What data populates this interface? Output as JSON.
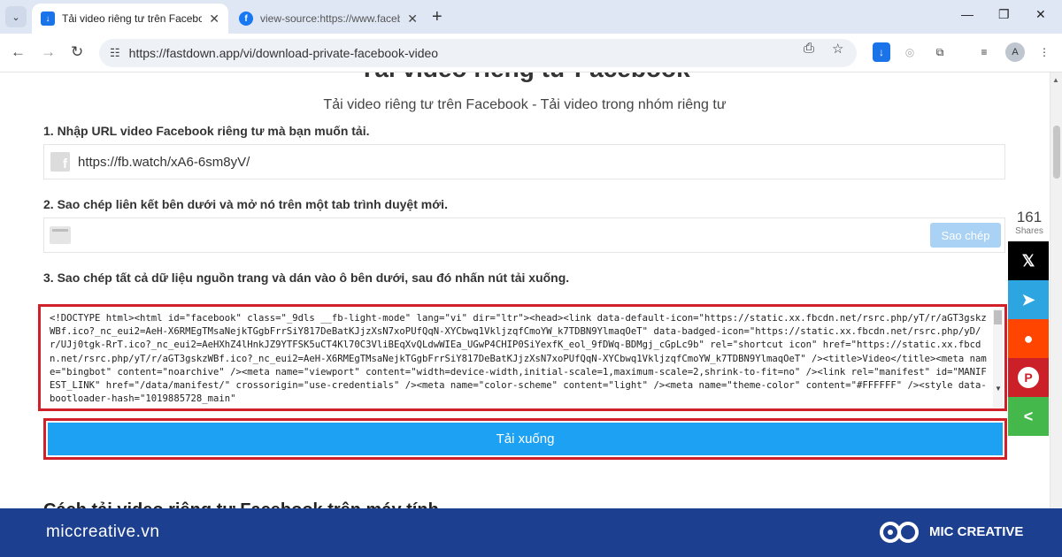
{
  "browser": {
    "tabs": [
      {
        "title": "Tải video riêng tư trên Faceboo",
        "active": true
      },
      {
        "title": "view-source:https://www.faceb",
        "active": false
      }
    ],
    "address": "https://fastdown.app/vi/download-private-facebook-video",
    "profile_initial": "A"
  },
  "page": {
    "heading": "Tải video riêng tư Facebook",
    "subtitle": "Tải video riêng tư trên Facebook - Tải video trong nhóm riêng tư",
    "step1": {
      "label": "1. Nhập URL video Facebook riêng tư mà bạn muốn tải.",
      "value": "https://fb.watch/xA6-6sm8yV/"
    },
    "step2": {
      "label": "2. Sao chép liên kết bên dưới và mở nó trên một tab trình duyệt mới.",
      "copy_button": "Sao chép"
    },
    "step3": {
      "label": "3. Sao chép tất cả dữ liệu nguồn trang và dán vào ô bên dưới, sau đó nhấn nút tải xuống.",
      "source_code": "<!DOCTYPE html><html id=\"facebook\" class=\"_9dls __fb-light-mode\" lang=\"vi\" dir=\"ltr\"><head><link data-default-icon=\"https://static.xx.fbcdn.net/rsrc.php/yT/r/aGT3gskzWBf.ico?_nc_eui2=AeH-X6RMEgTMsaNejkTGgbFrrSiY817DeBatKJjzXsN7xoPUfQqN-XYCbwq1VkljzqfCmoYW_k7TDBN9YlmaqOeT\" data-badged-icon=\"https://static.xx.fbcdn.net/rsrc.php/yD/r/UJj0tgk-RrT.ico?_nc_eui2=AeHXhZ4lHnkJZ9YTFSK5uCT4Kl70C3VliBEqXvQLdwWIEa_UGwP4CHIP0SiYexfK_eol_9fDWq-BDMgj_cGpLc9b\" rel=\"shortcut icon\" href=\"https://static.xx.fbcdn.net/rsrc.php/yT/r/aGT3gskzWBf.ico?_nc_eui2=AeH-X6RMEgTMsaNejkTGgbFrrSiY817DeBatKJjzXsN7xoPUfQqN-XYCbwq1VkljzqfCmoYW_k7TDBN9YlmaqOeT\" /><title>Video</title><meta name=\"bingbot\" content=\"noarchive\" /><meta name=\"viewport\" content=\"width=device-width,initial-scale=1,maximum-scale=2,shrink-to-fit=no\" /><link rel=\"manifest\" id=\"MANIFEST_LINK\" href=\"/data/manifest/\" crossorigin=\"use-credentials\" /><meta name=\"color-scheme\" content=\"light\" /><meta name=\"theme-color\" content=\"#FFFFFF\" /><style data-bootloader-hash=\"1019885728_main\""
    },
    "download_button": "Tải xuống",
    "next_heading": "Cách tải video riêng tư Facebook trên máy tính"
  },
  "share": {
    "count": "161",
    "label": "Shares",
    "buttons": [
      {
        "name": "x",
        "glyph": "𝕏",
        "color": "#000000"
      },
      {
        "name": "telegram",
        "glyph": "➤",
        "color": "#2ca5e0"
      },
      {
        "name": "reddit",
        "glyph": "●",
        "color": "#ff4500"
      },
      {
        "name": "pinterest",
        "glyph": "P",
        "color": "#cb2027"
      },
      {
        "name": "sharethis",
        "glyph": "<",
        "color": "#44b84a"
      }
    ]
  },
  "footer": {
    "site": "miccreative.vn",
    "brand": "MIC CREATIVE"
  },
  "colors": {
    "highlight": "#d0202a",
    "primary": "#1da1f2",
    "footer_bg": "#1c3f8f"
  }
}
